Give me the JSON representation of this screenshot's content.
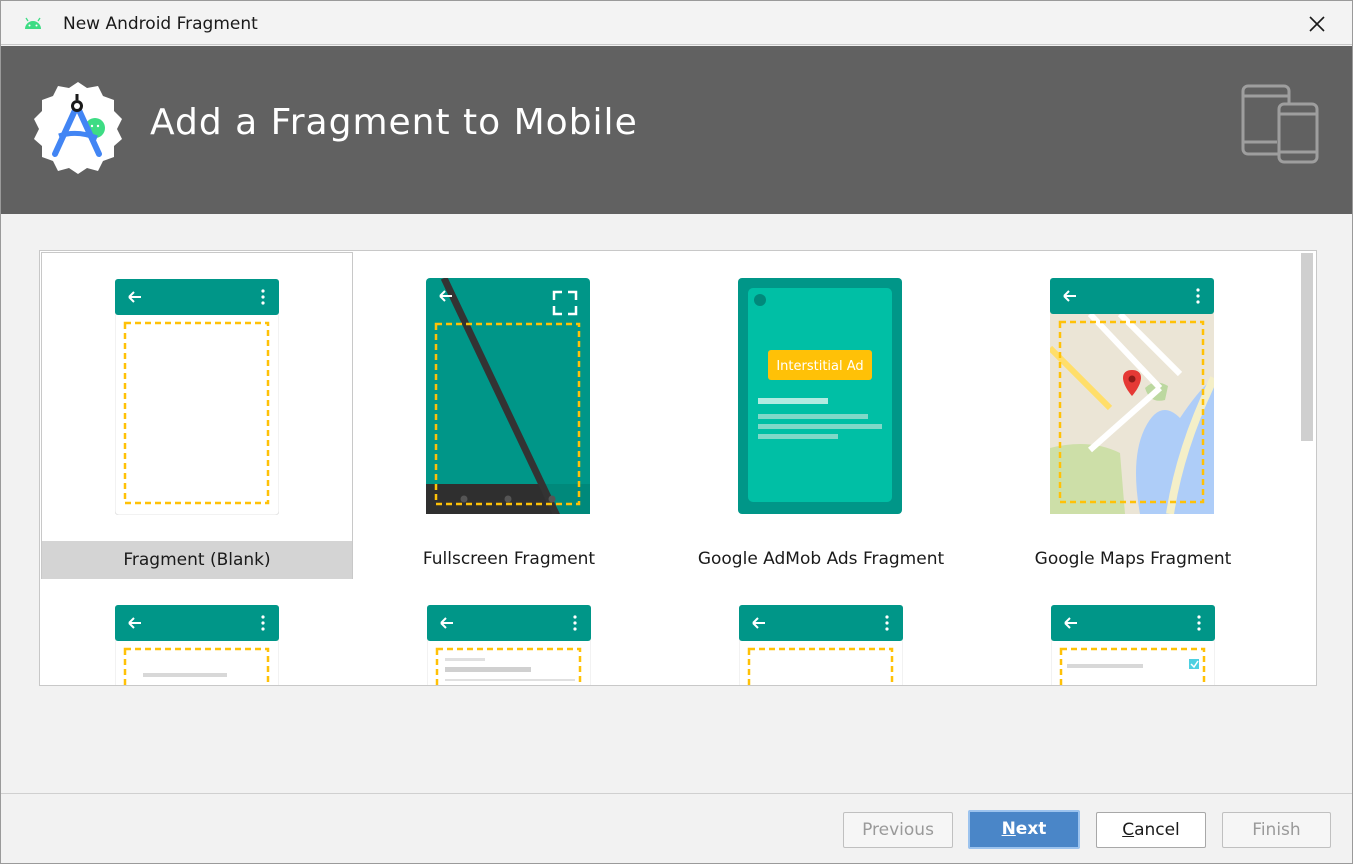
{
  "window": {
    "title": "New Android Fragment",
    "close_glyph": "✕"
  },
  "banner": {
    "title": "Add a Fragment to Mobile",
    "logo_icon": "android-studio-logo-icon",
    "device_icon": "phone-tablet-icon",
    "background": "#616161"
  },
  "gallery": {
    "selected_index": 0,
    "templates": [
      {
        "label": "Fragment (Blank)"
      },
      {
        "label": "Fullscreen Fragment"
      },
      {
        "label": "Google AdMob Ads Fragment",
        "ad_label": "Interstitial Ad"
      },
      {
        "label": "Google Maps Fragment"
      }
    ]
  },
  "buttons": {
    "previous": "Previous",
    "next_mnemonic": "N",
    "next_rest": "ext",
    "cancel_mnemonic": "C",
    "cancel_rest": "ancel",
    "finish": "Finish"
  },
  "colors": {
    "teal": "#009688",
    "teal_light": "#00bfa5",
    "amber": "#ffc107",
    "primary_button": "#4a86c8"
  }
}
